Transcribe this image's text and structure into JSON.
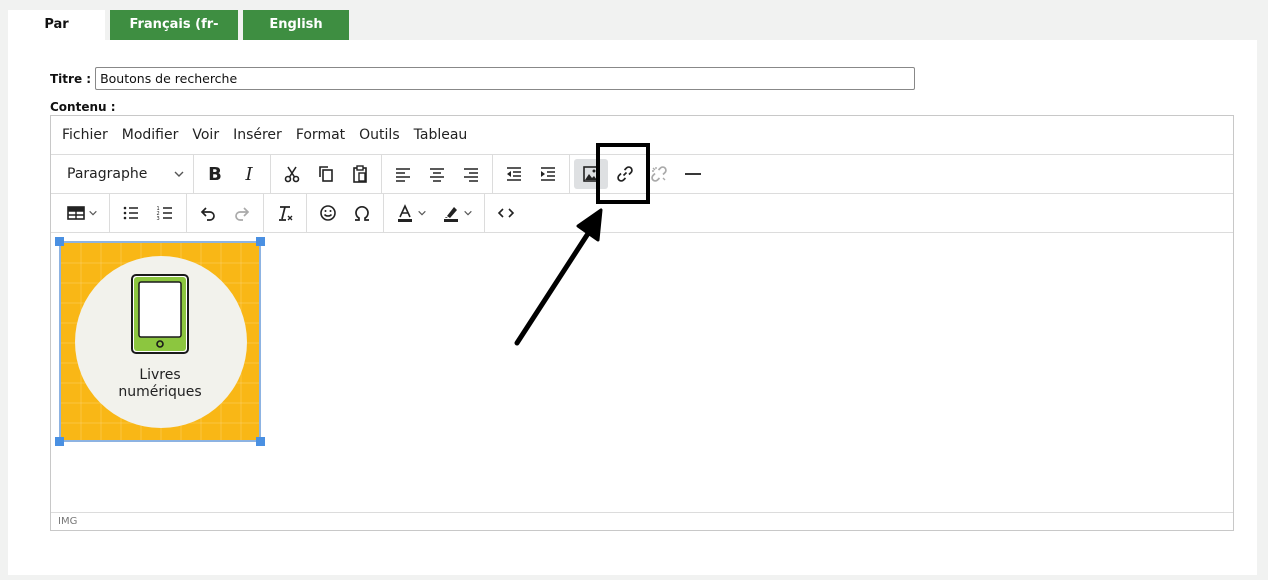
{
  "tabs": [
    {
      "label": "Par défaut"
    },
    {
      "label": "Français (fr-CA)"
    },
    {
      "label": "English (en)"
    }
  ],
  "form": {
    "title_label": "Titre :",
    "title_value": "Boutons de recherche",
    "content_label": "Contenu :"
  },
  "menubar": [
    "Fichier",
    "Modifier",
    "Voir",
    "Insérer",
    "Format",
    "Outils",
    "Tableau"
  ],
  "toolbar": {
    "block_format": "Paragraphe"
  },
  "image": {
    "caption_line1": "Livres",
    "caption_line2": "numériques",
    "background_color": "#f9b716",
    "circle_color": "#f2f2ec",
    "tablet_color": "#8cc63f"
  },
  "statusbar": {
    "path": "IMG"
  },
  "colors": {
    "tab_green": "#3e8e41",
    "selection_blue": "#4a90e2"
  }
}
